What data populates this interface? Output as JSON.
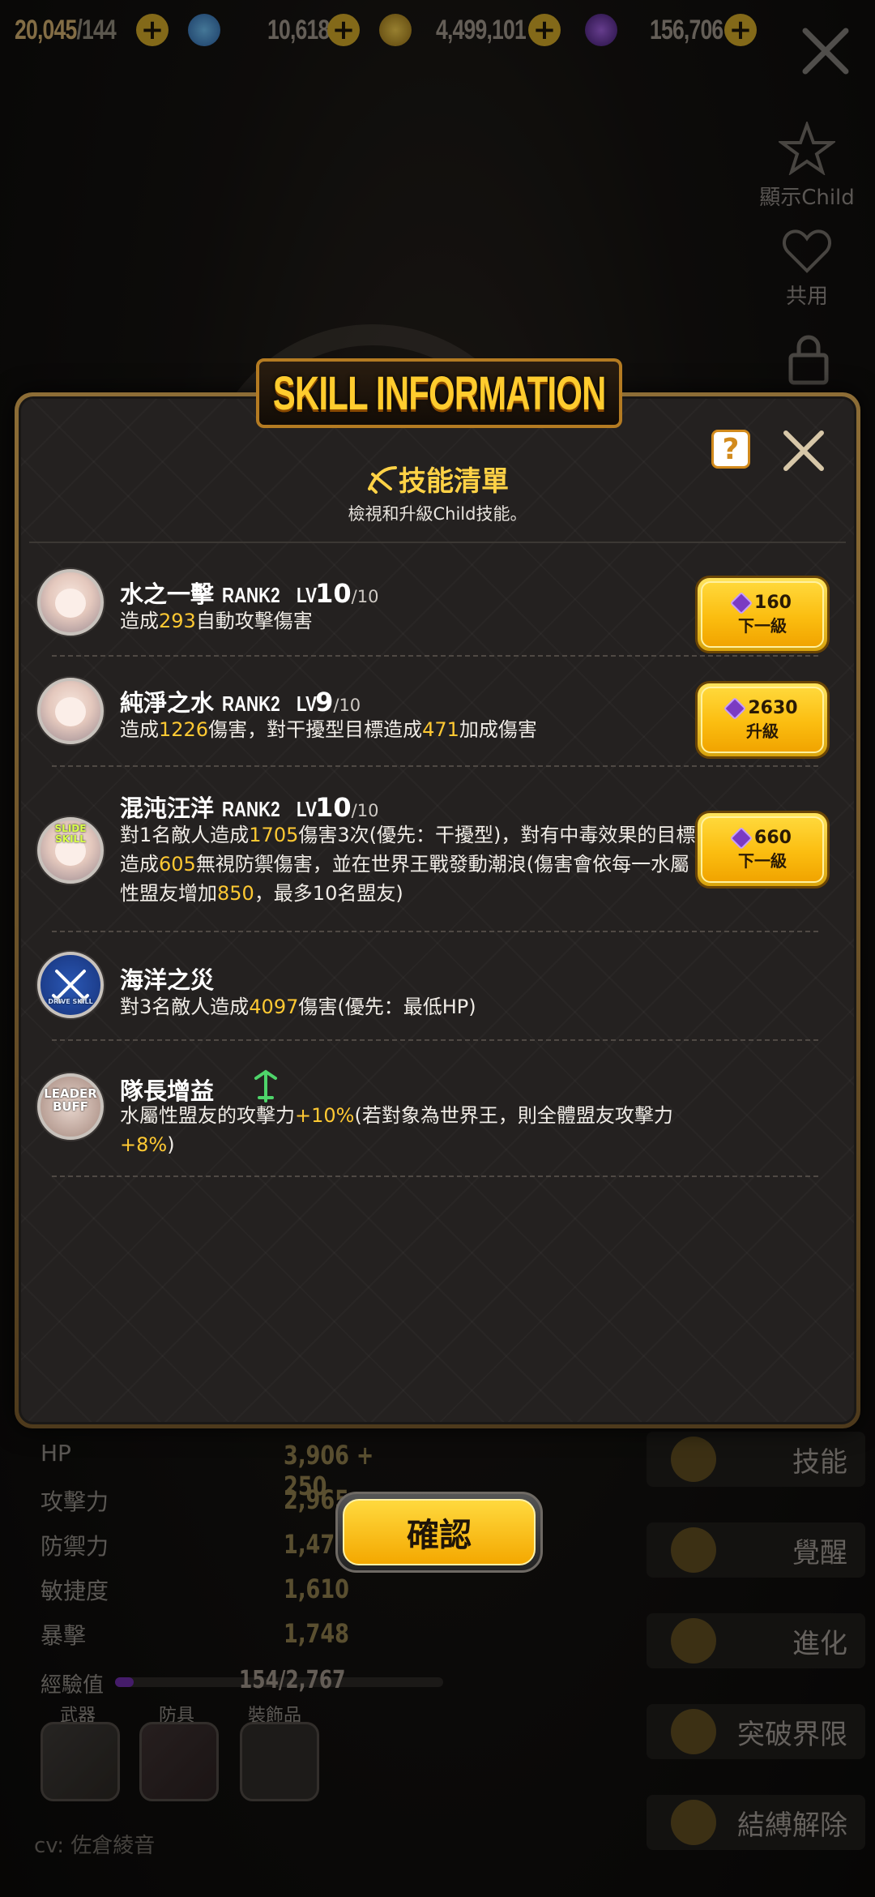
{
  "currencies": [
    {
      "value": "20,045",
      "suffix": "/144",
      "icon": "stamina-icon"
    },
    {
      "value": "10,618",
      "icon": "crystal-ball-icon"
    },
    {
      "value": "4,499,101",
      "icon": "gold-coin-icon"
    },
    {
      "value": "156,706",
      "icon": "gem-icon"
    }
  ],
  "side": {
    "show_child": "顯示Child",
    "share": "共用"
  },
  "stats": [
    {
      "label": "HP",
      "value": "3,906 + 250"
    },
    {
      "label": "攻擊力",
      "value": "2,965"
    },
    {
      "label": "防禦力",
      "value": "1,479"
    },
    {
      "label": "敏捷度",
      "value": "1,610"
    },
    {
      "label": "暴擊",
      "value": "1,748"
    }
  ],
  "exp": {
    "label": "經驗值",
    "value": "154/2,767",
    "progress": 0.056
  },
  "equipment": {
    "weapon": "武器",
    "armor": "防具",
    "accessory": "裝飾品"
  },
  "cv": "cv: 佐倉綾音",
  "menu": [
    "技能",
    "覺醒",
    "進化",
    "突破界限",
    "結縛解除"
  ],
  "panel": {
    "title": "SKILL INFORMATION",
    "heading": "技能清單",
    "subheading": "檢視和升級Child技能。",
    "help": "?"
  },
  "skills": [
    {
      "name": "水之一擊",
      "rank": "RANK2",
      "lv_prefix": "LV",
      "lv": "10",
      "lv_max": "/10",
      "desc": [
        [
          "造成",
          ""
        ],
        [
          "293",
          "hl"
        ],
        [
          "自動攻擊傷害",
          ""
        ]
      ],
      "button": {
        "cost": "160",
        "label": "下一級"
      }
    },
    {
      "name": "純淨之水",
      "rank": "RANK2",
      "lv_prefix": "LV",
      "lv": "9",
      "lv_max": "/10",
      "desc": [
        [
          "造成",
          ""
        ],
        [
          "1226",
          "hl"
        ],
        [
          "傷害，對干擾型目標造成",
          ""
        ],
        [
          "471",
          "hl"
        ],
        [
          "加成傷害",
          ""
        ]
      ],
      "button": {
        "cost": "2630",
        "label": "升級"
      }
    },
    {
      "name": "混沌汪洋",
      "rank": "RANK2",
      "lv_prefix": "LV",
      "lv": "10",
      "lv_max": "/10",
      "badge": "SLIDE SKILL",
      "desc": [
        [
          "對1名敵人造成",
          ""
        ],
        [
          "1705",
          "hl"
        ],
        [
          "傷害3次(優先：干擾型)，對有中毒效果的目標造成",
          ""
        ],
        [
          "605",
          "hl"
        ],
        [
          "無視防禦傷害，並在世界王戰發動潮浪(傷害會依每一水屬性盟友增加",
          ""
        ],
        [
          "850",
          "hl"
        ],
        [
          "，最多10名盟友)",
          ""
        ]
      ],
      "button": {
        "cost": "660",
        "label": "下一級"
      }
    },
    {
      "name": "海洋之災",
      "badge": "DRIVE SKILL",
      "desc": [
        [
          "對3名敵人造成",
          ""
        ],
        [
          "4097",
          "hl"
        ],
        [
          "傷害(優先：最低HP)",
          ""
        ]
      ]
    },
    {
      "name": "隊長增益",
      "badge": "LEADER BUFF",
      "desc": [
        [
          "水屬性盟友的攻擊力",
          ""
        ],
        [
          "+10%",
          "hl"
        ],
        [
          "(若對象為世界王，則全體盟友攻擊力",
          ""
        ],
        [
          "+8%",
          "hl"
        ],
        [
          ")",
          ""
        ]
      ]
    }
  ],
  "confirm": "確認",
  "colors": {
    "accent": "#ffc933",
    "button": "#fbbd10",
    "panel_border": "#8d6d36"
  }
}
